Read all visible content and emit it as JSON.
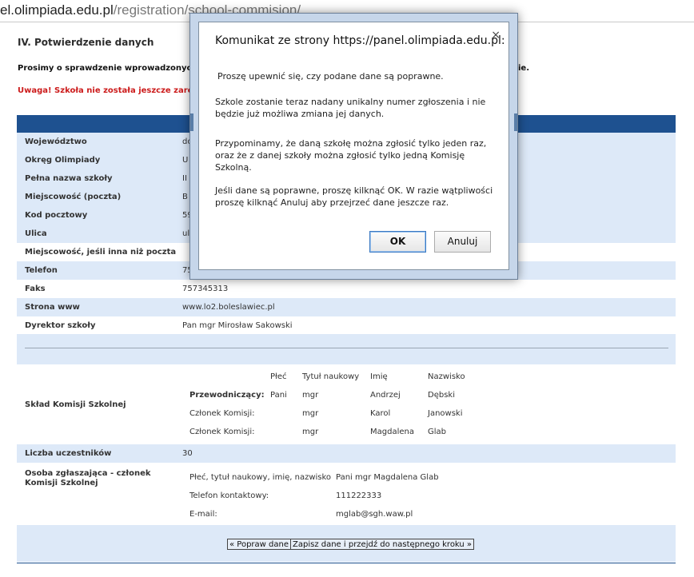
{
  "browser": {
    "url_host": "el.olimpiada.edu.pl",
    "url_path": "/registration/school-commision/"
  },
  "page": {
    "section_title": "IV. Potwierdzenie danych",
    "intro_text": "Prosimy o sprawdzenie wprowadzonych dan",
    "intro_tail": "ie.",
    "warning_text": "Uwaga! Szkoła nie została jeszcze zarejestr"
  },
  "school": {
    "rows": [
      {
        "label": "Województwo",
        "value": "do"
      },
      {
        "label": "Okręg Olimpiady",
        "value": "U"
      },
      {
        "label": "Pełna nazwa szkoły",
        "value": "II"
      },
      {
        "label": "Miejscowość (poczta)",
        "value": "B"
      },
      {
        "label": "Kod pocztowy",
        "value": "59"
      },
      {
        "label": "Ulica",
        "value": "ul"
      },
      {
        "label": "Miejscowość, jeśli inna niż poczta",
        "value": ""
      },
      {
        "label": "Telefon",
        "value": "75"
      },
      {
        "label": "Faks",
        "value": "757345313"
      },
      {
        "label": "Strona www",
        "value": "www.lo2.boleslawiec.pl"
      },
      {
        "label": "Dyrektor szkoły",
        "value": "Pan mgr Mirosław Sakowski"
      }
    ]
  },
  "komisja": {
    "label": "Skład Komisji Szkolnej",
    "headers": {
      "plec": "Płeć",
      "tytul": "Tytuł naukowy",
      "imie": "Imię",
      "nazwisko": "Nazwisko"
    },
    "members": [
      {
        "role": "Przewodniczący:",
        "plec": "Pani",
        "tytul": "mgr",
        "imie": "Andrzej",
        "nazwisko": "Dębski"
      },
      {
        "role": "Członek Komisji:",
        "plec": "",
        "tytul": "mgr",
        "imie": "Karol",
        "nazwisko": "Janowski"
      },
      {
        "role": "Członek Komisji:",
        "plec": "",
        "tytul": "mgr",
        "imie": "Magdalena",
        "nazwisko": "Glab"
      }
    ]
  },
  "liczba": {
    "label": "Liczba uczestników",
    "value": "30"
  },
  "osoba": {
    "label": "Osoba zgłaszająca - członek Komisji Szkolnej",
    "fields": [
      {
        "label": "Płeć, tytuł naukowy, imię, nazwisko",
        "value": "Pani mgr Magdalena Glab"
      },
      {
        "label": "Telefon kontaktowy:",
        "value": "111222333"
      },
      {
        "label": "E-mail:",
        "value": "mglab@sgh.waw.pl"
      }
    ]
  },
  "buttons": {
    "back": "« Popraw dane",
    "save": "Zapisz dane i przejdź do następnego kroku »"
  },
  "dialog": {
    "title": "Komunikat ze strony https://panel.olimpiada.edu.pl:",
    "close_glyph": "×",
    "p1": "Proszę upewnić się, czy podane dane są poprawne.",
    "p2": "Szkole zostanie teraz nadany unikalny numer zgłoszenia i nie będzie już możliwa zmiana jej danych.",
    "p3": "Przypominamy, że daną szkołę można zgłosić tylko jeden raz, oraz że z danej szkoły można zgłosić tylko jedną Komisję Szkolną.",
    "p4": "Jeśli dane są poprawne, proszę kilknąć OK. W razie wątpliwości proszę kilknąć Anuluj aby przejrzeć dane jeszcze raz.",
    "ok_label": "OK",
    "cancel_label": "Anuluj"
  },
  "colors": {
    "header_blue": "#1e5190",
    "row_alt": "#dde9f8",
    "warning_red": "#cc1b1b"
  }
}
